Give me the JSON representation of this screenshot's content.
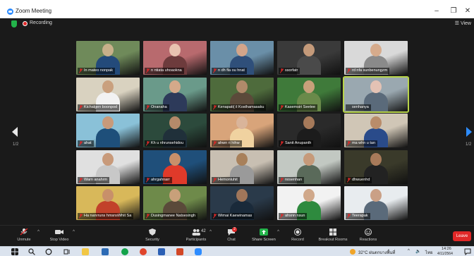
{
  "window": {
    "title": "Zoom Meeting",
    "buttons": [
      "–",
      "❐",
      "✕"
    ]
  },
  "meeting": {
    "recording_label": "Recording",
    "view_label": "☰ View",
    "page_indicator_left": "1/2",
    "page_indicator_right": "1/2"
  },
  "participants": [
    {
      "name": "In mateo nonpak",
      "muted": true
    },
    {
      "name": "n ntiata uhoaokna",
      "muted": true
    },
    {
      "name": "n dh fla ou hnat",
      "muted": true
    },
    {
      "name": "ssorfatr",
      "muted": true
    },
    {
      "name": "rd nfa sunbenungzm",
      "muted": true
    },
    {
      "name": "Kichalgen boonpod",
      "muted": true
    },
    {
      "name": "Onanaha",
      "muted": true
    },
    {
      "name": "Kenapati( il Kosthamasaku",
      "muted": true
    },
    {
      "name": "Kasemsiri Seetee",
      "muted": true
    },
    {
      "name": "senhanya",
      "muted": false
    },
    {
      "name": "ahat",
      "muted": true
    },
    {
      "name": "Kh u nhrunsehidou",
      "muted": true
    },
    {
      "name": "ahwn ri hihw",
      "muted": true
    },
    {
      "name": "Sanit Anupanth",
      "muted": true
    },
    {
      "name": "ma whn u tan",
      "muted": true
    },
    {
      "name": "Warn anahrm",
      "muted": true
    },
    {
      "name": "ahrgahnarr",
      "muted": true
    },
    {
      "name": "Hemonluhit",
      "muted": true
    },
    {
      "name": "nosenhan",
      "muted": true
    },
    {
      "name": "dhwuenhd",
      "muted": true
    },
    {
      "name": "Ha nanrruns hmsnsWhit Sa",
      "muted": true
    },
    {
      "name": "Dusingmanee Natsesingh",
      "muted": true
    },
    {
      "name": "Wimai Kaewinamas",
      "muted": true
    },
    {
      "name": "ahsnn nsun",
      "muted": true
    },
    {
      "name": "Teerapak",
      "muted": true
    }
  ],
  "toolbar": {
    "unmute": "Unmute",
    "stop_video": "Stop Video",
    "security": "Security",
    "participants": "Participants",
    "participants_count": "42",
    "chat": "Chat",
    "chat_badge": "2",
    "share_screen": "Share Screen",
    "record": "Record",
    "breakout_rooms": "Breakout Rooms",
    "reactions": "Reactions",
    "leave": "Leave"
  },
  "taskbar": {
    "weather": "32°C ฝนตกบางพื้นที่",
    "language": "ไทย",
    "time": "14:26",
    "date": "4/11/2564"
  }
}
